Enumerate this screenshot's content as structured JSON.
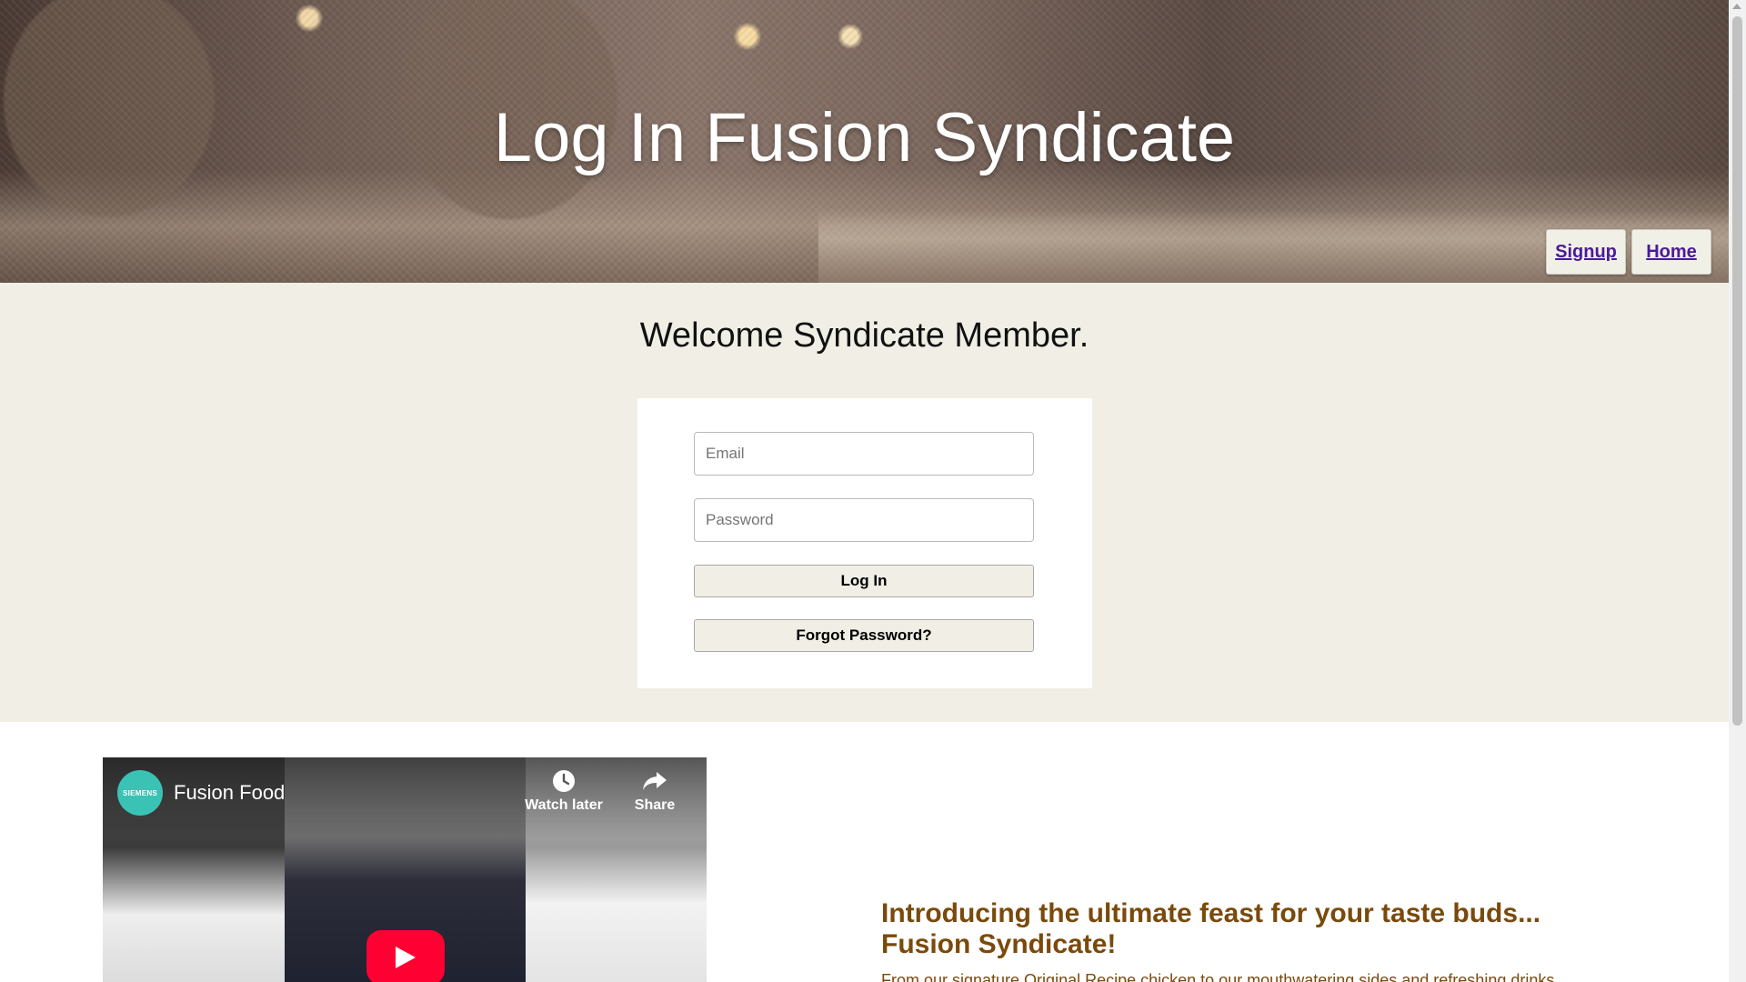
{
  "header": {
    "title": "Log In Fusion Syndicate",
    "nav": [
      {
        "label": "Signup"
      },
      {
        "label": "Home"
      }
    ]
  },
  "login": {
    "welcome": "Welcome Syndicate Member.",
    "email_placeholder": "Email",
    "password_placeholder": "Password",
    "login_label": "Log In",
    "forgot_label": "Forgot Password?"
  },
  "video": {
    "channel_logo_text": "SIEMENS",
    "title": "Fusion Food",
    "watch_later_label": "Watch later",
    "share_label": "Share",
    "watch_later_icon": "clock-icon",
    "share_icon": "share-arrow-icon",
    "play_icon": "play-icon",
    "player_accent": "#ff0033"
  },
  "intro": {
    "heading_line1": "Introducing the ultimate feast for your taste buds...",
    "heading_line2": "Fusion Syndicate!",
    "body": "From our signature Original Recipe chicken to our mouthwatering sides and refreshing drinks"
  },
  "colors": {
    "page_bg": "#f1efe5",
    "link": "#4a1a9a",
    "intro_text": "#7a4a0c"
  }
}
